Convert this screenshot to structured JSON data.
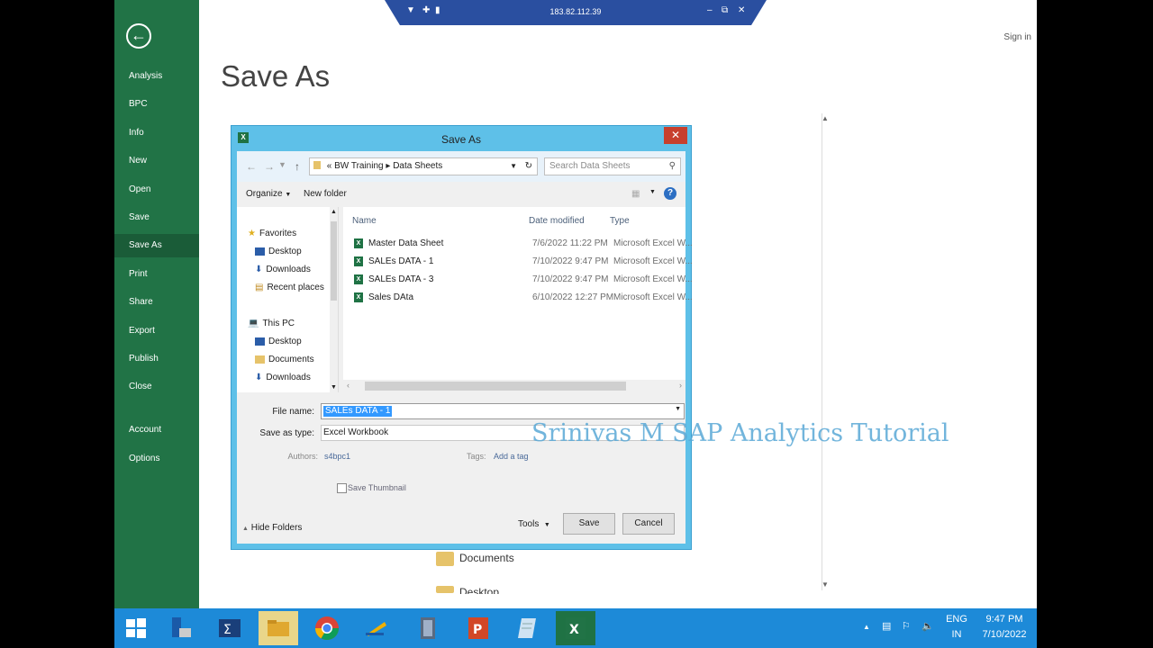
{
  "remote_session": {
    "ip": "183.82.112.39"
  },
  "backstage": {
    "items": [
      {
        "label": "Analysis"
      },
      {
        "label": "BPC"
      },
      {
        "label": "Info"
      },
      {
        "label": "New"
      },
      {
        "label": "Open"
      },
      {
        "label": "Save"
      },
      {
        "label": "Save As",
        "active": true
      },
      {
        "label": "Print"
      },
      {
        "label": "Share"
      },
      {
        "label": "Export"
      },
      {
        "label": "Publish"
      },
      {
        "label": "Close"
      },
      {
        "label": "Account"
      },
      {
        "label": "Options"
      }
    ],
    "sign_in": "Sign in",
    "page_title": "Save As",
    "background_folders": [
      "Documents",
      "Desktop"
    ]
  },
  "dialog": {
    "title": "Save As",
    "breadcrumb": [
      "«",
      "BW Training",
      "Data Sheets"
    ],
    "search_placeholder": "Search Data Sheets",
    "organize": "Organize",
    "new_folder": "New folder",
    "nav_pane": {
      "favorites": "Favorites",
      "favorites_items": [
        "Desktop",
        "Downloads",
        "Recent places"
      ],
      "this_pc": "This PC",
      "this_pc_items": [
        "Desktop",
        "Documents",
        "Downloads"
      ]
    },
    "columns": {
      "name": "Name",
      "date": "Date modified",
      "type": "Type"
    },
    "files": [
      {
        "name": "Master Data Sheet",
        "date": "7/6/2022 11:22 PM",
        "type": "Microsoft Excel W..."
      },
      {
        "name": "SALEs DATA - 1",
        "date": "7/10/2022 9:47 PM",
        "type": "Microsoft Excel W..."
      },
      {
        "name": "SALEs DATA - 3",
        "date": "7/10/2022 9:47 PM",
        "type": "Microsoft Excel W..."
      },
      {
        "name": "Sales DAta",
        "date": "6/10/2022 12:27 PM",
        "type": "Microsoft Excel W..."
      }
    ],
    "file_name_label": "File name:",
    "file_name_value": "SALEs DATA - 1",
    "save_type_label": "Save as type:",
    "save_type_value": "Excel Workbook",
    "authors_label": "Authors:",
    "authors_value": "s4bpc1",
    "tags_label": "Tags:",
    "tags_value": "Add a tag",
    "thumbnail_label": "Save Thumbnail",
    "hide_folders": "Hide Folders",
    "tools": "Tools",
    "save": "Save",
    "cancel": "Cancel"
  },
  "watermark": "Srinivas M SAP Analytics Tutorial",
  "taskbar": {
    "apps": [
      "start-icon",
      "server-manager-icon",
      "powershell-icon",
      "file-explorer-icon",
      "chrome-icon",
      "sap-icon",
      "sap-gui-icon",
      "powerpoint-icon",
      "notepad-icon",
      "excel-icon"
    ],
    "language": "ENG",
    "region": "IN",
    "time": "9:47 PM",
    "date": "7/10/2022"
  },
  "colors": {
    "excel_green": "#217346",
    "dialog_frame": "#5ec0e8",
    "taskbar": "#1d8ad8"
  }
}
